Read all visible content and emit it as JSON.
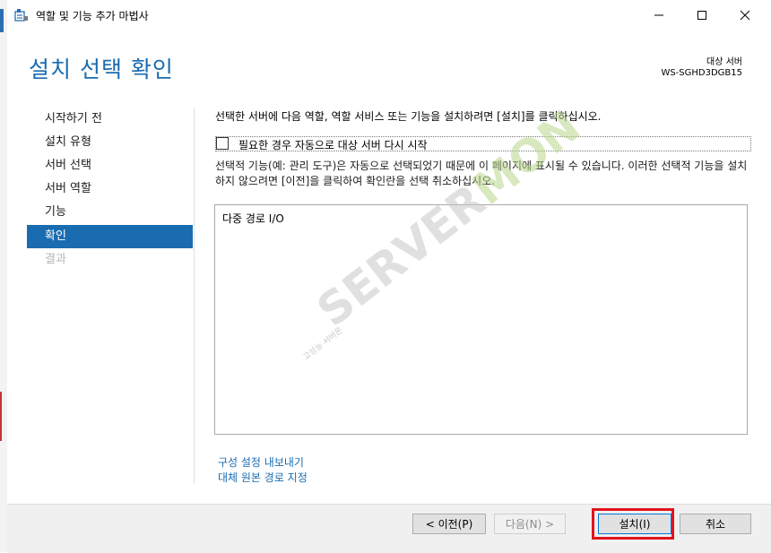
{
  "window": {
    "title": "역할 및 기능 추가 마법사",
    "controls": {
      "minimize": "—",
      "maximize": "☐",
      "close": "✕"
    }
  },
  "header": {
    "title": "설치 선택 확인",
    "destination_label": "대상 서버",
    "destination_name": "WS-SGHD3DGB15"
  },
  "nav": {
    "items": [
      {
        "label": "시작하기 전",
        "state": "normal"
      },
      {
        "label": "설치 유형",
        "state": "normal"
      },
      {
        "label": "서버 선택",
        "state": "normal"
      },
      {
        "label": "서버 역할",
        "state": "normal"
      },
      {
        "label": "기능",
        "state": "normal"
      },
      {
        "label": "확인",
        "state": "active"
      },
      {
        "label": "결과",
        "state": "disabled"
      }
    ]
  },
  "content": {
    "intro": "선택한 서버에 다음 역할, 역할 서비스 또는 기능을 설치하려면 [설치]를 클릭하십시오.",
    "restart_checkbox": {
      "label": "필요한 경우 자동으로 대상 서버 다시 시작",
      "checked": false
    },
    "optional_note": "선택적 기능(예: 관리 도구)은 자동으로 선택되었기 때문에 이 페이지에 표시될 수 있습니다. 이러한 선택적 기능을 설치하지 않으려면 [이전]을 클릭하여 확인란을 선택 취소하십시오.",
    "features": [
      "다중 경로 I/O"
    ],
    "links": {
      "export": "구성 설정 내보내기",
      "alt_source": "대체 원본 경로 지정"
    }
  },
  "watermark": {
    "text_main": "SERVER",
    "text_accent": "MON",
    "text_small": "고성능 서버몬"
  },
  "buttons": {
    "previous": "< 이전(P)",
    "next": "다음(N) >",
    "install": "설치(I)",
    "cancel": "취소"
  },
  "colors": {
    "accent": "#1a6cb0",
    "highlight": "#e0141e"
  }
}
